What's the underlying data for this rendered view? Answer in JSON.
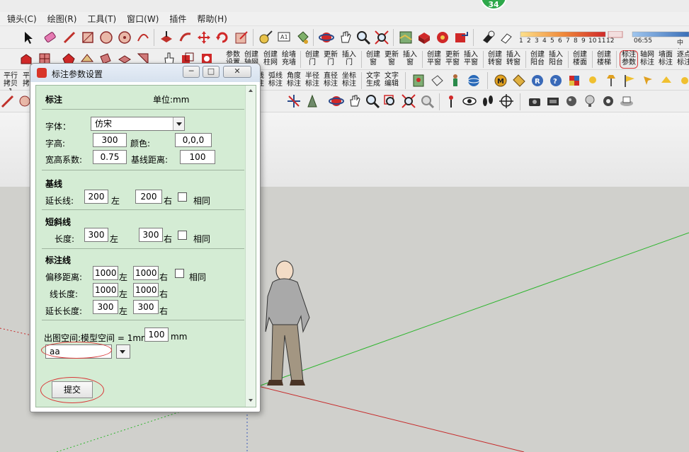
{
  "menu": [
    "镜头(C)",
    "绘图(R)",
    "工具(T)",
    "窗口(W)",
    "插件",
    "帮助(H)"
  ],
  "badge": "34",
  "ruler": {
    "months": [
      "1",
      "2",
      "3",
      "4",
      "5",
      "6",
      "7",
      "8",
      "9",
      "10",
      "11",
      "12"
    ],
    "time": "06:55",
    "time_right": "中午"
  },
  "toolbar2": {
    "labels": [
      [
        "参数",
        "设置"
      ],
      [
        "创建",
        "轴网"
      ],
      [
        "创建",
        "柱网"
      ],
      [
        "绘墙",
        "充墙"
      ],
      [
        "创建",
        "门"
      ],
      [
        "更新",
        "门"
      ],
      [
        "插入",
        "门"
      ],
      [
        "创建",
        "窗"
      ],
      [
        "更新",
        "窗"
      ],
      [
        "插入",
        "窗"
      ],
      [
        "创建",
        "平窗"
      ],
      [
        "更新",
        "平窗"
      ],
      [
        "插入",
        "平窗"
      ],
      [
        "创建",
        "转窗"
      ],
      [
        "插入",
        "转窗"
      ],
      [
        "创建",
        "阳台"
      ],
      [
        "插入",
        "阳台"
      ],
      [
        "创建",
        "楼面"
      ],
      [
        "创建",
        "楼梯"
      ],
      [
        "标注",
        "参数"
      ],
      [
        "轴网",
        "标注"
      ],
      [
        "墙面",
        "标注"
      ],
      [
        "逐点",
        "标注"
      ]
    ]
  },
  "toolbar3": {
    "left_labels": [
      [
        "平行",
        "拷贝1"
      ],
      [
        "平",
        "拷"
      ]
    ],
    "labels": [
      [
        "线",
        "注"
      ],
      [
        "弧线",
        "标注"
      ],
      [
        "角度",
        "标注"
      ],
      [
        "半径",
        "标注"
      ],
      [
        "直径",
        "标注"
      ],
      [
        "坐标",
        "标注"
      ],
      [
        "文字",
        "生成"
      ],
      [
        "文字",
        "编辑"
      ]
    ]
  },
  "dialog": {
    "title": "标注参数设置",
    "win_buttons": [
      "─",
      "□",
      "✕"
    ],
    "header": "标注",
    "unit": "单位:mm",
    "font_label": "字体：",
    "font_value": "仿宋",
    "height_label": "字高:",
    "height_value": "300",
    "color_label": "颜色:",
    "color_value": "0,0,0",
    "ratio_label": "宽高系数:",
    "ratio_value": "0.75",
    "baseline_dist_label": "基线距离:",
    "baseline_dist_value": "100",
    "baseline": {
      "title": "基线",
      "ext_label": "延长线:",
      "left_value": "200",
      "left_unit": "左",
      "right_value": "200",
      "right_unit": "右",
      "same_label": "相同"
    },
    "tick": {
      "title": "短斜线",
      "len_label": "长度:",
      "left_value": "300",
      "left_unit": "左",
      "right_value": "300",
      "right_unit": "右",
      "same_label": "相同"
    },
    "dimline": {
      "title": "标注线",
      "offset_label": "偏移距离:",
      "offset_left": "1000",
      "offset_right": "1000",
      "line_label": "线长度:",
      "line_left": "1000",
      "line_right": "1000",
      "ext_label": "延长长度:",
      "ext_left": "300",
      "ext_right": "300",
      "left_unit": "左",
      "right_unit": "右",
      "same_label": "相同"
    },
    "scale_label": "出图空间:模型空间 = 1mm:",
    "scale_value": "100",
    "scale_unit": "mm",
    "combo_value": "aa",
    "submit_label": "提交"
  },
  "colors": {
    "dialog_body": "#d4ecd4",
    "axis_green": "#2db52d",
    "axis_red": "#c62828",
    "highlight_oval": "#d93838"
  }
}
